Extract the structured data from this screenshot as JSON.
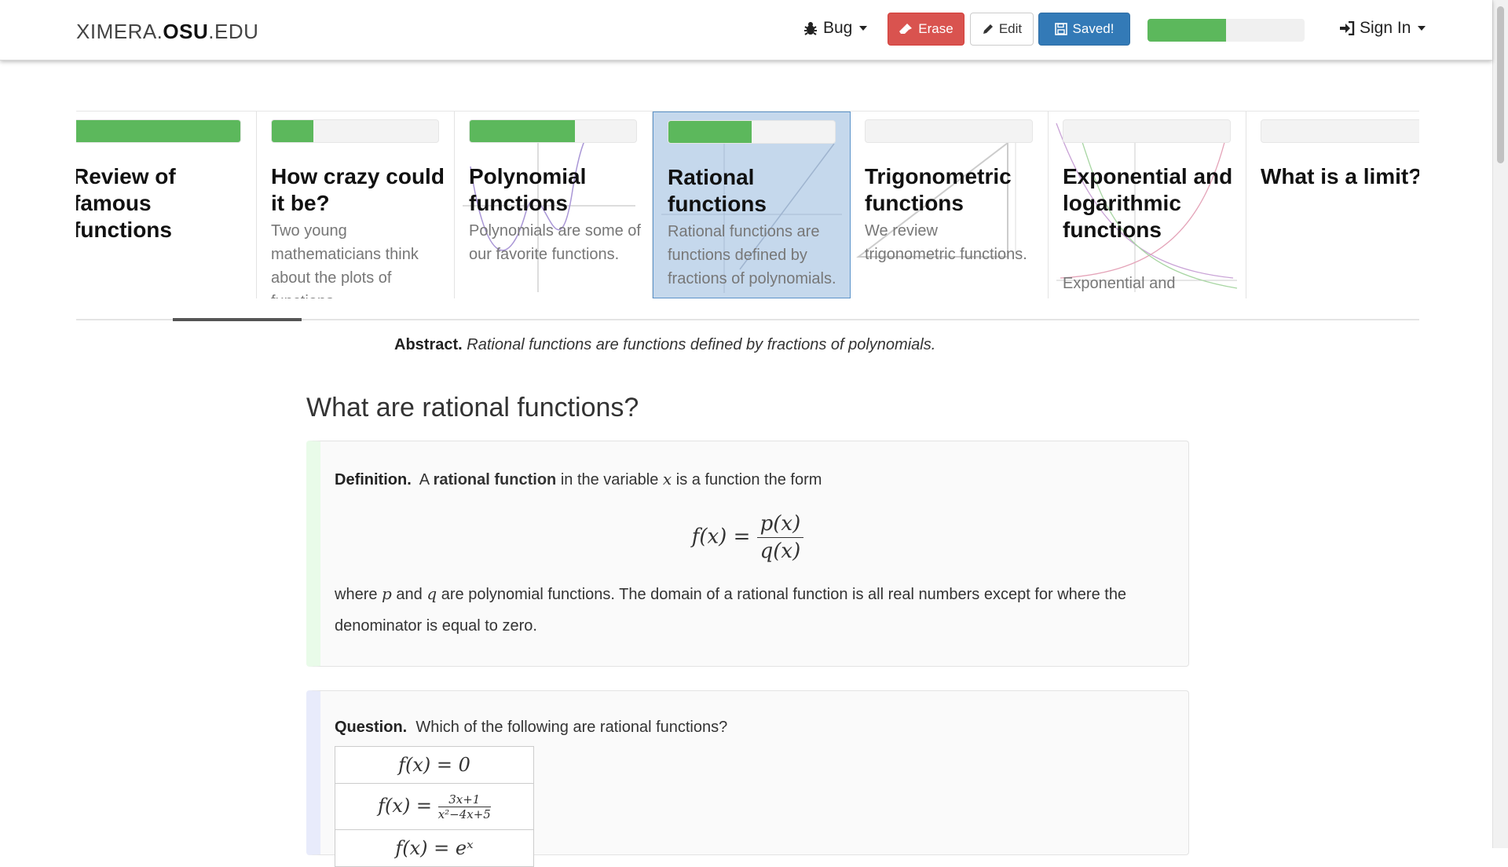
{
  "navbar": {
    "brand_prefix": "XIMERA.",
    "brand_bold": "OSU",
    "brand_suffix": ".EDU",
    "bug_label": "Bug",
    "erase_label": "Erase",
    "edit_label": "Edit",
    "saved_label": "Saved!",
    "progress_fraction": 0.5,
    "signin_label": "Sign In"
  },
  "carousel": {
    "cards": [
      {
        "title": "Review of famous functions",
        "summary": "",
        "progress": 1.0,
        "active": false
      },
      {
        "title": "How crazy could it be?",
        "summary": "Two young mathematicians think about the plots of functions.",
        "progress": 0.25,
        "active": false
      },
      {
        "title": "Polynomial functions",
        "summary": "Polynomials are some of our favorite functions.",
        "progress": 0.63,
        "active": false
      },
      {
        "title": "Rational functions",
        "summary": "Rational functions are functions defined by fractions of polynomials.",
        "progress": 0.5,
        "active": true
      },
      {
        "title": "Trigonometric functions",
        "summary": "We review trigonometric functions.",
        "progress": 0.0,
        "active": false
      },
      {
        "title": "Exponential and logarithmic functions",
        "summary": "Exponential and",
        "progress": 0.0,
        "active": false
      },
      {
        "title": "What is a limit?",
        "summary": "",
        "progress": 0.0,
        "active": false
      }
    ]
  },
  "abstract": {
    "label": "Abstract.",
    "text": "Rational functions are functions defined by fractions of polynomials."
  },
  "section": {
    "title": "What are rational functions?"
  },
  "definition": {
    "label": "Definition.",
    "intro_pre": "A",
    "term": "rational function",
    "intro_mid": "in the variable",
    "var": "x",
    "intro_post": "is a function the form",
    "formula_lhs": "f(x) =",
    "formula_num": "p(x)",
    "formula_den": "q(x)",
    "body_pre": "where",
    "p": "p",
    "and": "and",
    "q": "q",
    "body_post": "are polynomial functions. The domain of a rational function is all real numbers except for where the denominator is equal to zero."
  },
  "question": {
    "label": "Question.",
    "text": "Which of the following are rational functions?",
    "choices": {
      "c1": "f(x) = 0",
      "c2_lhs": "f(x) =",
      "c2_num": "3x+1",
      "c2_den": "x²−4x+5",
      "c3": "f(x) = eˣ"
    }
  }
}
